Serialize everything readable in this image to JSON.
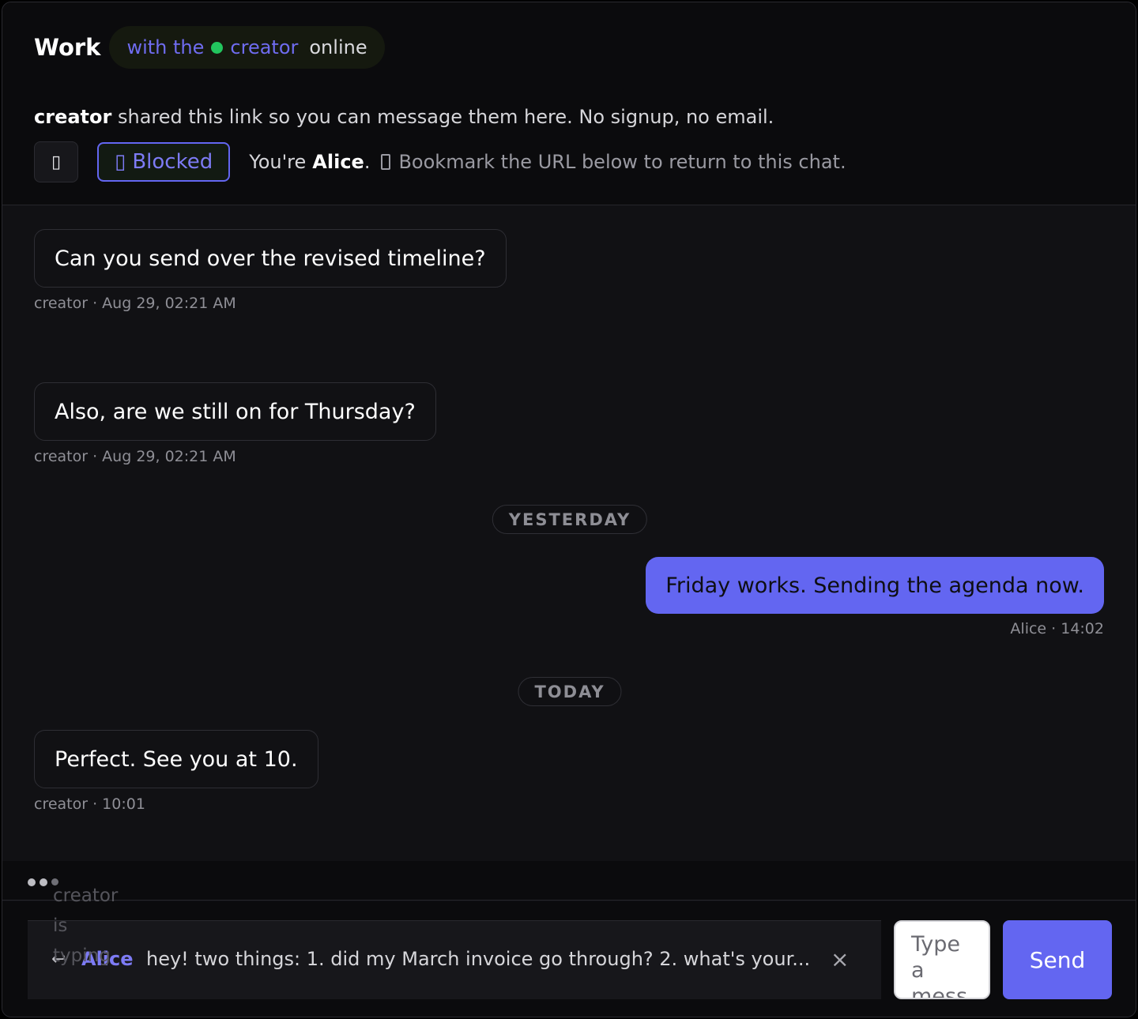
{
  "header": {
    "title": "Work",
    "presence": {
      "prefix": "with the",
      "name": "creator",
      "status": "online",
      "dot_color": "#22c55e"
    },
    "intro": {
      "name": "creator",
      "text": "shared this link so you can message them here. No signup, no email."
    },
    "blocked_label": "Blocked",
    "identity": {
      "prefix": "You're",
      "name": "Alice",
      "suffix": ".",
      "hint": "Bookmark the URL below to return to this chat."
    }
  },
  "messages": [
    {
      "sender": "creator",
      "text": "Can you send over the revised timeline?",
      "meta": "creator · Aug 29, 02:21 AM"
    },
    {
      "sender": "creator",
      "text": "Also, are we still on for Thursday?",
      "meta": "creator · Aug 29, 02:21 AM"
    },
    {
      "separator": "YESTERDAY"
    },
    {
      "sender": "Alice",
      "text": "Friday works. Sending the agenda now.",
      "meta": "Alice · 14:02"
    },
    {
      "separator": "TODAY"
    },
    {
      "sender": "creator",
      "text": "Perfect. See you at 10.",
      "meta": "creator · 10:01"
    }
  ],
  "typing": {
    "text": "creator is typing"
  },
  "reply": {
    "arrow": "↩",
    "name": "Alice",
    "text": "hey! two things: 1. did my March invoice go through? 2. what's your...",
    "close": "×"
  },
  "composer": {
    "placeholder": "Type a message",
    "send_label": "Send"
  },
  "colors": {
    "accent": "#6366f1",
    "online": "#22c55e",
    "background": "#111114"
  }
}
